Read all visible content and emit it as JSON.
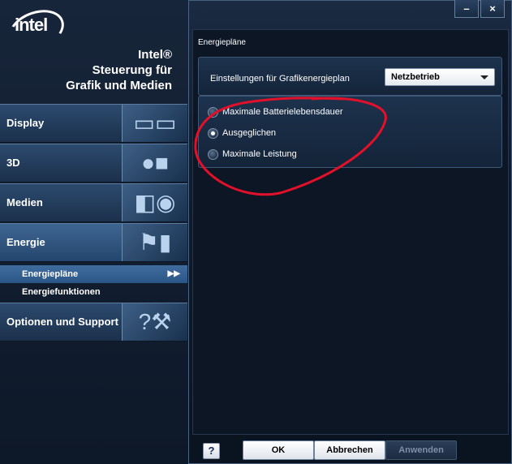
{
  "window": {
    "brand_line1": "Intel®",
    "brand_line2": "Steuerung für",
    "brand_line3": "Grafik und Medien",
    "logo": "intel",
    "minimize_label": "–",
    "close_label": "×"
  },
  "sidebar": {
    "items": [
      {
        "label": "Display",
        "icon": "display-icon"
      },
      {
        "label": "3D",
        "icon": "3d-icon"
      },
      {
        "label": "Medien",
        "icon": "media-icon"
      },
      {
        "label": "Energie",
        "icon": "energy-icon"
      },
      {
        "label": "Optionen und Support",
        "icon": "support-icon"
      }
    ],
    "subitems": [
      {
        "label": "Energiepläne",
        "active": true,
        "arrow": "▶▶"
      },
      {
        "label": "Energiefunktionen",
        "active": false
      }
    ]
  },
  "main": {
    "title": "Energiepläne",
    "setting_label": "Einstellungen für Grafikenergieplan",
    "select_value": "Netzbetrieb",
    "radios": [
      {
        "label": "Maximale Batterielebensdauer",
        "checked": false
      },
      {
        "label": "Ausgeglichen",
        "checked": true
      },
      {
        "label": "Maximale Leistung",
        "checked": false
      }
    ]
  },
  "footer": {
    "help_label": "?",
    "ok_label": "OK",
    "cancel_label": "Abbrechen",
    "apply_label": "Anwenden"
  },
  "colors": {
    "accent": "#3f6c9e",
    "annotation": "#e3102a"
  }
}
